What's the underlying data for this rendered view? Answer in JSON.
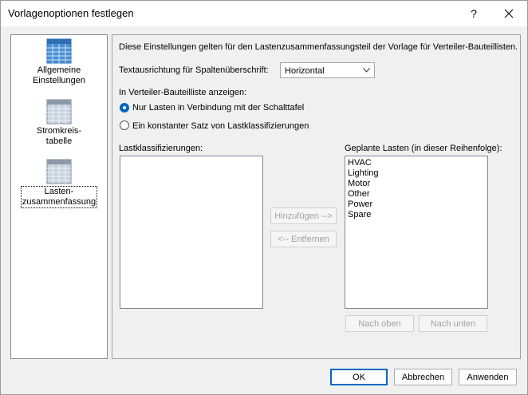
{
  "window": {
    "title": "Vorlagenoptionen festlegen",
    "help_glyph": "?"
  },
  "sidebar": {
    "items": [
      {
        "line1": "Allgemeine",
        "line2": "Einstellungen",
        "icon": "grid-table-icon-blue"
      },
      {
        "line1": "Stromkreis-",
        "line2": "tabelle",
        "icon": "table-icon-gray"
      },
      {
        "line1": "Lasten-",
        "line2": "zusammenfassung",
        "icon": "table-icon-gray",
        "selected": true
      }
    ]
  },
  "content": {
    "description": "Diese Einstellungen gelten für den Lastenzusammenfassungsteil der Vorlage für Verteiler-Bauteillisten.",
    "header_direction_label": "Textausrichtung für Spaltenüberschrift:",
    "header_direction_value": "Horizontal",
    "show_in_list_label": "In Verteiler-Bauteilliste anzeigen:",
    "radio_option_1": "Nur Lasten in Verbindung mit der Schalttafel",
    "radio_option_2": "Ein konstanter Satz von Lastklassifizierungen",
    "radio_selected": 1,
    "load_classifications_label": "Lastklassifizierungen:",
    "planned_loads_label": "Geplante Lasten (in dieser Reihenfolge):",
    "planned_loads": [
      "HVAC",
      "Lighting",
      "Motor",
      "Other",
      "Power",
      "Spare"
    ],
    "add_button": "Hinzufügen -->",
    "remove_button": "<-- Entfernen",
    "move_up_button": "Nach oben",
    "move_down_button": "Nach unten"
  },
  "footer": {
    "ok": "OK",
    "cancel": "Abbrechen",
    "apply": "Anwenden"
  },
  "colors": {
    "accent": "#0067c0",
    "icon_blue": "#4a8fd4",
    "icon_gray": "#8c99a8"
  }
}
